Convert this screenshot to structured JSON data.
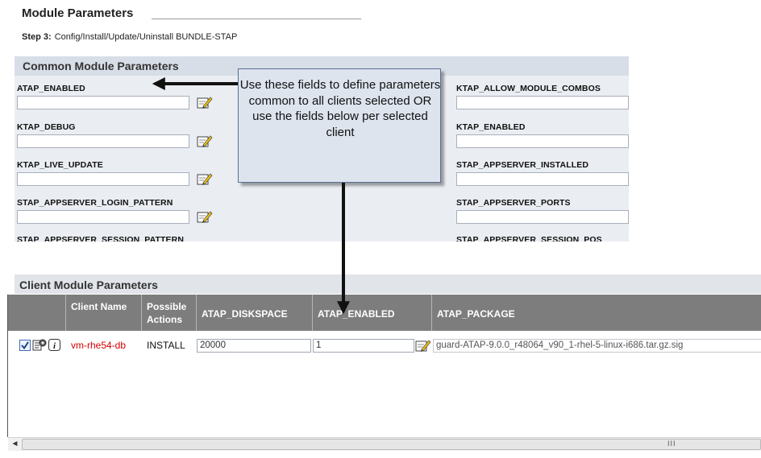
{
  "page": {
    "title": "Module Parameters",
    "step_label": "Step 3:",
    "step_text": "Config/Install/Update/Uninstall BUNDLE-STAP"
  },
  "common": {
    "title": "Common Module Parameters",
    "left_params": [
      {
        "label": "ATAP_ENABLED",
        "value": ""
      },
      {
        "label": "KTAP_DEBUG",
        "value": ""
      },
      {
        "label": "KTAP_LIVE_UPDATE",
        "value": ""
      },
      {
        "label": "STAP_APPSERVER_LOGIN_PATTERN",
        "value": ""
      },
      {
        "label": "STAP_APPSERVER_SESSION_PATTERN",
        "value": ""
      }
    ],
    "right_params": [
      {
        "label": "KTAP_ALLOW_MODULE_COMBOS",
        "value": ""
      },
      {
        "label": "KTAP_ENABLED",
        "value": ""
      },
      {
        "label": "STAP_APPSERVER_INSTALLED",
        "value": ""
      },
      {
        "label": "STAP_APPSERVER_PORTS",
        "value": ""
      },
      {
        "label": "STAP_APPSERVER_SESSION_POS",
        "value": ""
      }
    ]
  },
  "callout": {
    "text": "Use these fields to define parameters common to all clients selected OR use the fields below per selected client"
  },
  "client": {
    "title": "Client Module Parameters",
    "columns": {
      "client_name": "Client Name",
      "possible_actions": "Possible Actions",
      "atap_diskspace": "ATAP_DISKSPACE",
      "atap_enabled": "ATAP_ENABLED",
      "atap_package": "ATAP_PACKAGE"
    },
    "rows": [
      {
        "selected": true,
        "name": "vm-rhe54-db",
        "action": "INSTALL",
        "atap_diskspace": "20000",
        "atap_enabled": "1",
        "atap_package": "guard-ATAP-9.0.0_r48064_v90_1-rhel-5-linux-i686.tar.gz.sig"
      }
    ]
  },
  "scrollbar": {
    "left_arrow": "◄",
    "grip": "III"
  },
  "colors": {
    "client_name": "#d40000",
    "table_header": "#7d7d7d",
    "section_header": "#d8dee7",
    "callout_bg": "#dde4ee"
  }
}
